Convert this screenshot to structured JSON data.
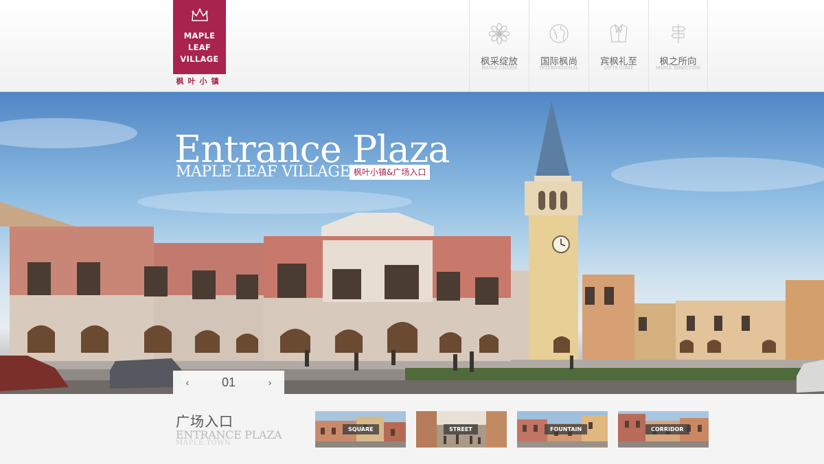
{
  "logo": {
    "line1": "MAPLE",
    "line2": "LEAF",
    "line3": "VILLAGE",
    "cn": "枫叶小镇",
    "color": "#a8234d"
  },
  "nav": [
    {
      "cn": "枫采绽放",
      "en": "MAPLE CHARM",
      "icon": "flower-icon"
    },
    {
      "cn": "国际枫尚",
      "en": "INTERNATIONAL",
      "icon": "globe-icon"
    },
    {
      "cn": "宾枫礼至",
      "en": "GIFTS COME",
      "icon": "coat-icon"
    },
    {
      "cn": "枫之所向",
      "en": "MAPLE DIRECTION",
      "icon": "signpost-icon"
    }
  ],
  "hero": {
    "title": "Entrance Plaza",
    "subtitle": "MAPLE LEAF VILLAGE",
    "tag": "枫叶小镇&广场入口"
  },
  "pager": {
    "current": "01",
    "prev": "‹",
    "next": "›"
  },
  "section": {
    "cn": "广场入口",
    "en": "ENTRANCE PLAZA",
    "en2": "MAPLE TOWN"
  },
  "thumbs": [
    {
      "label": "SQUARE"
    },
    {
      "label": "STREET"
    },
    {
      "label": "FOUNTAIN"
    },
    {
      "label": "CORRIDOR"
    }
  ]
}
